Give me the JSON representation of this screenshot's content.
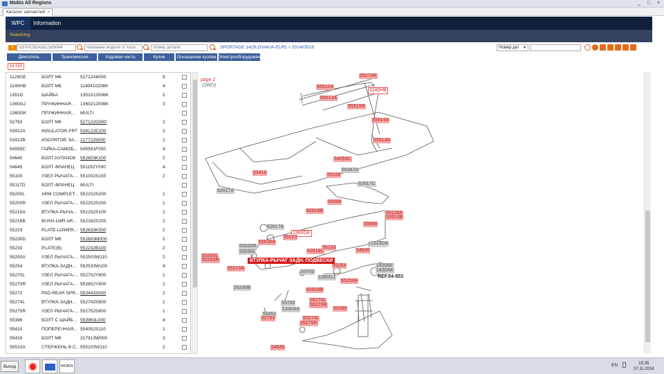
{
  "window": {
    "title": "Mobis All Regions",
    "min": "_",
    "max": "□",
    "close": "×"
  },
  "tab": {
    "label": "Каталог запчастей",
    "close": "×"
  },
  "nav": {
    "wpc": "WPC",
    "info": "Information"
  },
  "sub": {
    "searching": "Searching"
  },
  "search": {
    "add": "+",
    "vin": "USYPC81ADEL505044",
    "model_ph": "Название модели ог Ката",
    "part_ph": "Номер детали",
    "breadcrumb_model": "SPORTAGE 14(SLOVAKIA-EUR)",
    "breadcrumb_sep": " > ",
    "breadcrumb_date": "2014/05/15",
    "select": "Номер дет",
    "select_arrow": "▼"
  },
  "categories": [
    "Двигатель",
    "Трансмиссия",
    "Ходовая часть",
    "Кузов",
    "Оснащение кузова",
    "Электрооборудован"
  ],
  "group_tag": "54-555",
  "parts": [
    {
      "code": "1129GE",
      "name": "БОЛТ M6",
      "pn": "52712A6000",
      "qty": "8",
      "u": false
    },
    {
      "code": "1140HB",
      "name": "БОЛТ M6",
      "pn": "1140410206K",
      "qty": "4",
      "u": false
    },
    {
      "code": "1351D",
      "name": "ШАЙБА",
      "pn": "1351012006K",
      "qty": "2",
      "u": false
    },
    {
      "code": "1360GJ",
      "name": "ПРУЖИННАЯ...",
      "pn": "1360212006K",
      "qty": "3",
      "u": false
    },
    {
      "code": "1360GK",
      "name": "ПРУЖИННАЯ...",
      "pn": "MULTI",
      "qty": "",
      "u": false
    },
    {
      "code": "52763",
      "name": "БОЛТ M6",
      "pn": "527122G000",
      "qty": "2",
      "u": true
    },
    {
      "code": "53912A",
      "name": "INSULATOR-FRT",
      "pn": "539122E200",
      "qty": "2",
      "u": true
    },
    {
      "code": "53912B",
      "name": "ИЗОЛЯТОР, ЗА...",
      "pn": "2177225000",
      "qty": "1",
      "u": true
    },
    {
      "code": "54559C",
      "name": "ГАЙКА-САМОБ...",
      "pn": "545591F000",
      "qty": "4",
      "u": false
    },
    {
      "code": "54640",
      "name": "БОЛТ-КУЛАЧОК",
      "pn": "552603K100",
      "qty": "2",
      "u": true
    },
    {
      "code": "54645",
      "name": "БОЛТ-ФЛАНЕЦ",
      "pn": "551192Y000",
      "qty": "4",
      "u": false
    },
    {
      "code": "55100",
      "name": "УЗЕЛ РЫЧАГА-...",
      "pn": "551002S150",
      "qty": "2",
      "u": false
    },
    {
      "code": "55117D",
      "name": "БОЛТ-ФЛАНЕЦ",
      "pn": "MULTI",
      "qty": "",
      "u": false
    },
    {
      "code": "55200L",
      "name": "ARM COMPLET...",
      "pn": "552152S200",
      "qty": "1",
      "u": false
    },
    {
      "code": "55200R",
      "name": "УЗЕЛ РЫЧАГА-...",
      "pn": "552202S200",
      "qty": "1",
      "u": false
    },
    {
      "code": "55215A",
      "name": "ВТУЛКА-РЫЧА...",
      "pn": "552152S100",
      "qty": "1",
      "u": false
    },
    {
      "code": "55216B",
      "name": "BUSH-LWR AR...",
      "pn": "552162S200",
      "qty": "2",
      "u": false
    },
    {
      "code": "55223",
      "name": "PLATE-LOWER...",
      "pn": "552633K000",
      "qty": "2",
      "u": true
    },
    {
      "code": "55230D",
      "name": "БОЛТ M6",
      "pn": "552603M000",
      "qty": "2",
      "u": true
    },
    {
      "code": "55233",
      "name": "PLATE(B)",
      "pn": "552232B100",
      "qty": "2",
      "u": true
    },
    {
      "code": "55250A",
      "name": "УЗЕЛ РЫЧАГА-...",
      "pn": "552503W110",
      "qty": "2",
      "u": false
    },
    {
      "code": "55254",
      "name": "ВТУЛКА-ЗАДН...",
      "pn": "552533W100",
      "qty": "4",
      "u": false
    },
    {
      "code": "55270L",
      "name": "УЗЕЛ РЫЧАГА-...",
      "pn": "552702Y800",
      "qty": "1",
      "u": false
    },
    {
      "code": "55270R",
      "name": "УЗЕЛ РЫЧАГА-...",
      "pn": "552802Y800",
      "qty": "1",
      "u": false
    },
    {
      "code": "55272",
      "name": "PAD-REAR SPR...",
      "pn": "553443S000",
      "qty": "2",
      "u": true
    },
    {
      "code": "55274L",
      "name": "ВТУЛКА-ЗАДН...",
      "pn": "552742S800",
      "qty": "1",
      "u": false
    },
    {
      "code": "55275R",
      "name": "УЗЕЛ РЫЧАГА-...",
      "pn": "552752S800",
      "qty": "1",
      "u": false
    },
    {
      "code": "55396",
      "name": "БОЛТ С ШАЙБ...",
      "pn": "553963L000",
      "qty": "4",
      "u": true
    },
    {
      "code": "55410",
      "name": "ПОПЕРЕЧНАЯ...",
      "pn": "554052S110",
      "qty": "1",
      "u": false
    },
    {
      "code": "55419",
      "name": "БОЛТ M6",
      "pn": "217913W000",
      "qty": "3",
      "u": false
    },
    {
      "code": "55510A",
      "name": "СТЕРЖЕНЬ В С...",
      "pn": "555103W110",
      "qty": "2",
      "u": false
    }
  ],
  "diagram": {
    "page": "page 2",
    "sub": "(2WD)",
    "tip": "ВТУЛКА-РЫЧАГ ЗАДН. ПОДВЕСКИ",
    "ref": "REF.54-553",
    "labels": [
      {
        "t": "55270R",
        "c": "r"
      },
      {
        "t": "55510A",
        "c": "r"
      },
      {
        "t": "1140HB",
        "c": "ro"
      },
      {
        "t": "55513A",
        "c": "r"
      },
      {
        "t": "55515R",
        "c": "r"
      },
      {
        "t": "55514A",
        "c": "r"
      },
      {
        "t": "55513A",
        "c": "r"
      },
      {
        "t": "54559C",
        "c": "r"
      },
      {
        "t": "55347A",
        "c": "g"
      },
      {
        "t": "55100",
        "c": "r"
      },
      {
        "t": "62617C",
        "c": "g"
      },
      {
        "t": "55410",
        "c": "r"
      },
      {
        "t": "62617A",
        "c": "g"
      },
      {
        "t": "55888",
        "c": "r"
      },
      {
        "t": "62618B",
        "c": "r"
      },
      {
        "t": "55118A",
        "c": "r"
      },
      {
        "t": "62618B",
        "c": "r"
      },
      {
        "t": "55888",
        "c": "r"
      },
      {
        "t": "62617A",
        "c": "g"
      },
      {
        "t": "1360GK",
        "c": "ro"
      },
      {
        "t": "55530A",
        "c": "r"
      },
      {
        "t": "55223",
        "c": "r"
      },
      {
        "t": "55530R",
        "c": "g"
      },
      {
        "t": "55530L",
        "c": "g"
      },
      {
        "t": "62617C",
        "c": "g"
      },
      {
        "t": "1313DA",
        "c": "g"
      },
      {
        "t": "55200L",
        "c": "r"
      },
      {
        "t": "55200R",
        "c": "r"
      },
      {
        "t": "62618B",
        "c": "r"
      },
      {
        "t": "55233",
        "c": "r"
      },
      {
        "t": "54640",
        "c": "r"
      },
      {
        "t": "55215A",
        "c": "r"
      },
      {
        "t": "55254",
        "c": "r"
      },
      {
        "t": "1430BF",
        "c": "g"
      },
      {
        "t": "1430AK",
        "c": "g"
      },
      {
        "t": "53700",
        "c": "g"
      },
      {
        "t": "1360GJ",
        "c": "g"
      },
      {
        "t": "55230B",
        "c": "g"
      },
      {
        "t": "55250A",
        "c": "r"
      },
      {
        "t": "62618B",
        "c": "r"
      },
      {
        "t": "53700",
        "c": "g"
      },
      {
        "t": "55270L",
        "c": "r"
      },
      {
        "t": "55270R",
        "c": "r"
      },
      {
        "t": "1330AA",
        "c": "g"
      },
      {
        "t": "55396",
        "c": "r"
      },
      {
        "t": "55451",
        "c": "g"
      },
      {
        "t": "52763",
        "c": "r"
      },
      {
        "t": "55274L",
        "c": "r"
      },
      {
        "t": "55275R",
        "c": "r"
      },
      {
        "t": "54645",
        "c": "r"
      }
    ]
  },
  "taskbar": {
    "exit": "Выход",
    "lang": "EN",
    "time": "15:35",
    "date": "07.11.2018",
    "app3": "MOBIS"
  }
}
